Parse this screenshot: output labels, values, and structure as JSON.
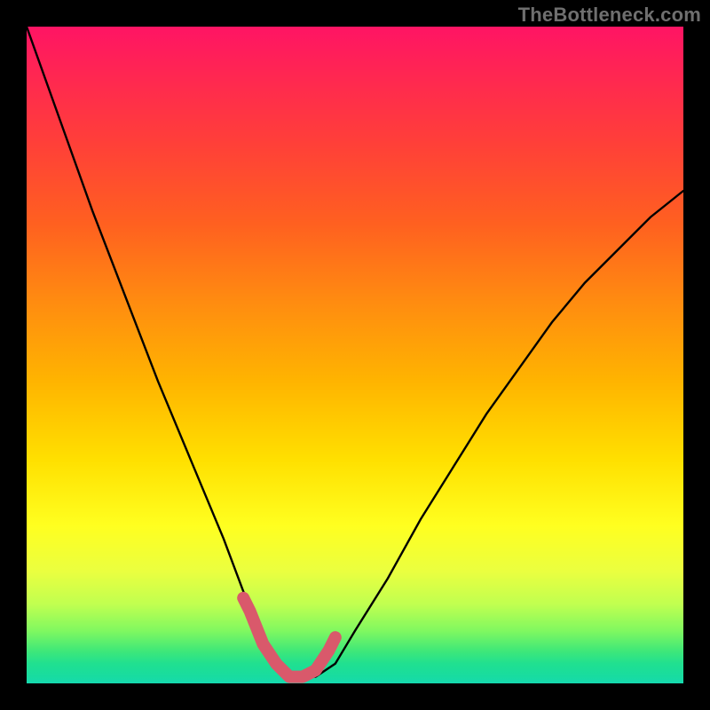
{
  "watermark": {
    "text": "TheBottleneck.com"
  },
  "colors": {
    "background": "#000000",
    "curve_thin": "#000000",
    "highlight": "#d9596b"
  },
  "chart_data": {
    "type": "line",
    "title": "",
    "xlabel": "",
    "ylabel": "",
    "xlim": [
      0,
      100
    ],
    "ylim": [
      0,
      100
    ],
    "grid": false,
    "series": [
      {
        "name": "dip-curve",
        "x": [
          0,
          5,
          10,
          15,
          20,
          25,
          30,
          33,
          36,
          38,
          40,
          42,
          44,
          47,
          50,
          55,
          60,
          65,
          70,
          75,
          80,
          85,
          90,
          95,
          100
        ],
        "y": [
          100,
          86,
          72,
          59,
          46,
          34,
          22,
          14,
          7,
          3,
          1,
          1,
          1,
          3,
          8,
          16,
          25,
          33,
          41,
          48,
          55,
          61,
          66,
          71,
          75
        ]
      },
      {
        "name": "dip-highlight",
        "x": [
          33,
          34,
          36,
          38,
          40,
          42,
          44,
          46,
          47
        ],
        "y": [
          13,
          11,
          6,
          3,
          1,
          1,
          2,
          5,
          7
        ]
      }
    ],
    "annotations": []
  }
}
